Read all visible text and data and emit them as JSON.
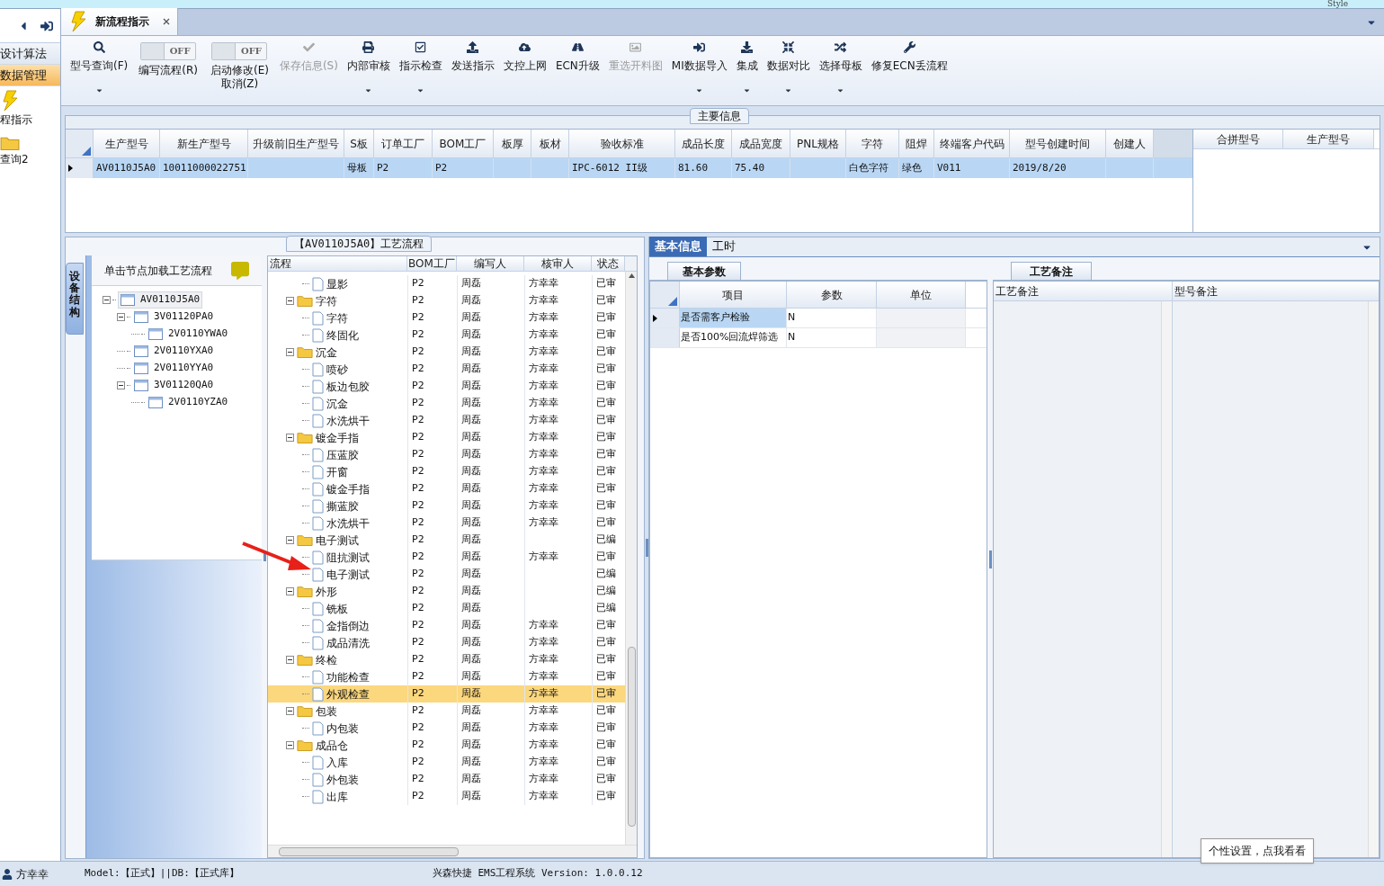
{
  "top_bar": {
    "style_label": "Style"
  },
  "nav": {
    "items": [
      {
        "label": "设计算法",
        "selected": false,
        "kind": "text"
      },
      {
        "label": "数据管理",
        "selected": true,
        "kind": "text"
      },
      {
        "label": "程指示",
        "selected": false,
        "kind": "lightning"
      },
      {
        "label": "查询2",
        "selected": false,
        "kind": "folder"
      }
    ]
  },
  "tabs": [
    {
      "label": "新流程指示",
      "selected": true
    }
  ],
  "toolbar": [
    {
      "kind": "button",
      "label": "型号查询(F)",
      "dropdown": true,
      "disabled": false
    },
    {
      "kind": "toggle",
      "label": "编写流程(R)",
      "toggle_text": "OFF",
      "on": false
    },
    {
      "kind": "toggle",
      "label": "启动修改(E)",
      "sublabel": "取消(Z)",
      "toggle_text": "OFF",
      "on": false
    },
    {
      "kind": "button",
      "label": "保存信息(S)",
      "dropdown": false,
      "disabled": true
    },
    {
      "kind": "button",
      "label": "内部审核",
      "dropdown": true,
      "disabled": false
    },
    {
      "kind": "button",
      "label": "指示检查",
      "dropdown": true,
      "disabled": false
    },
    {
      "kind": "button",
      "label": "发送指示",
      "dropdown": false,
      "disabled": false
    },
    {
      "kind": "button",
      "label": "文控上网",
      "dropdown": false,
      "disabled": false
    },
    {
      "kind": "button",
      "label": "ECN升级",
      "dropdown": false,
      "disabled": false
    },
    {
      "kind": "button",
      "label": "重选开料图",
      "dropdown": false,
      "disabled": true
    },
    {
      "kind": "button",
      "label": "MI数据导入",
      "dropdown": true,
      "disabled": false
    },
    {
      "kind": "button",
      "label": "集成",
      "dropdown": true,
      "disabled": false
    },
    {
      "kind": "button",
      "label": "数据对比",
      "dropdown": true,
      "disabled": false
    },
    {
      "kind": "button",
      "label": "选择母板",
      "dropdown": true,
      "disabled": false
    },
    {
      "kind": "button",
      "label": "修复ECN丢流程",
      "dropdown": false,
      "disabled": false
    }
  ],
  "main_info": {
    "title": "主要信息",
    "columns": [
      "生产型号",
      "新生产型号",
      "升级前旧生产型号",
      "S板",
      "订单工厂",
      "BOM工厂",
      "板厚",
      "板材",
      "验收标准",
      "成品长度",
      "成品宽度",
      "PNL规格",
      "字符",
      "阻焊",
      "终端客户代码",
      "型号创建时间",
      "创建人"
    ],
    "rows": [
      {
        "selected": true,
        "cells": [
          "AV0110J5A0",
          "10011000022751",
          "",
          "母板",
          "P2",
          "P2",
          "",
          "",
          "IPC-6012 II级",
          "81.60",
          "75.40",
          "",
          "白色字符",
          "绿色",
          "V011",
          "2019/8/20",
          ""
        ]
      }
    ],
    "merge_columns": [
      "合拼型号",
      "生产型号"
    ]
  },
  "structure": {
    "side_tab": "设备结构",
    "hint": "单击节点加载工艺流程",
    "tree": [
      {
        "label": "AV0110J5A0",
        "selected": true,
        "expanded": true,
        "children": [
          {
            "label": "3V01120PA0",
            "selected": false,
            "expanded": true,
            "children": [
              {
                "label": "2V0110YWA0",
                "selected": false
              }
            ]
          },
          {
            "label": "2V0110YXA0",
            "selected": false
          },
          {
            "label": "2V0110YYA0",
            "selected": false
          },
          {
            "label": "3V01120QA0",
            "selected": false,
            "expanded": true,
            "children": [
              {
                "label": "2V0110YZA0",
                "selected": false
              }
            ]
          }
        ]
      }
    ]
  },
  "flow": {
    "title": "【AV0110J5A0】工艺流程",
    "columns": [
      "流程",
      "BOM工厂",
      "编写人",
      "核审人",
      "状态"
    ],
    "rows": [
      {
        "kind": "leaf",
        "name": "显影",
        "bom": "P2",
        "writer": "周磊",
        "reviewer": "方幸幸",
        "status": "已审",
        "selected": false
      },
      {
        "kind": "folder",
        "name": "字符",
        "bom": "P2",
        "writer": "周磊",
        "reviewer": "方幸幸",
        "status": "已审",
        "selected": false,
        "children": [
          {
            "kind": "leaf",
            "name": "字符",
            "bom": "P2",
            "writer": "周磊",
            "reviewer": "方幸幸",
            "status": "已审",
            "selected": false
          },
          {
            "kind": "leaf",
            "name": "终固化",
            "bom": "P2",
            "writer": "周磊",
            "reviewer": "方幸幸",
            "status": "已审",
            "selected": false
          }
        ]
      },
      {
        "kind": "folder",
        "name": "沉金",
        "bom": "P2",
        "writer": "周磊",
        "reviewer": "方幸幸",
        "status": "已审",
        "selected": false,
        "children": [
          {
            "kind": "leaf",
            "name": "喷砂",
            "bom": "P2",
            "writer": "周磊",
            "reviewer": "方幸幸",
            "status": "已审",
            "selected": false
          },
          {
            "kind": "leaf",
            "name": "板边包胶",
            "bom": "P2",
            "writer": "周磊",
            "reviewer": "方幸幸",
            "status": "已审",
            "selected": false
          },
          {
            "kind": "leaf",
            "name": "沉金",
            "bom": "P2",
            "writer": "周磊",
            "reviewer": "方幸幸",
            "status": "已审",
            "selected": false
          },
          {
            "kind": "leaf",
            "name": "水洗烘干",
            "bom": "P2",
            "writer": "周磊",
            "reviewer": "方幸幸",
            "status": "已审",
            "selected": false
          }
        ]
      },
      {
        "kind": "folder",
        "name": "镀金手指",
        "bom": "P2",
        "writer": "周磊",
        "reviewer": "方幸幸",
        "status": "已审",
        "selected": false,
        "children": [
          {
            "kind": "leaf",
            "name": "压蓝胶",
            "bom": "P2",
            "writer": "周磊",
            "reviewer": "方幸幸",
            "status": "已审",
            "selected": false
          },
          {
            "kind": "leaf",
            "name": "开窗",
            "bom": "P2",
            "writer": "周磊",
            "reviewer": "方幸幸",
            "status": "已审",
            "selected": false
          },
          {
            "kind": "leaf",
            "name": "镀金手指",
            "bom": "P2",
            "writer": "周磊",
            "reviewer": "方幸幸",
            "status": "已审",
            "selected": false
          },
          {
            "kind": "leaf",
            "name": "撕蓝胶",
            "bom": "P2",
            "writer": "周磊",
            "reviewer": "方幸幸",
            "status": "已审",
            "selected": false
          },
          {
            "kind": "leaf",
            "name": "水洗烘干",
            "bom": "P2",
            "writer": "周磊",
            "reviewer": "方幸幸",
            "status": "已审",
            "selected": false
          }
        ]
      },
      {
        "kind": "folder",
        "name": "电子测试",
        "bom": "P2",
        "writer": "周磊",
        "status": "已编",
        "selected": false,
        "children": [
          {
            "kind": "leaf",
            "name": "阻抗测试",
            "bom": "P2",
            "writer": "周磊",
            "reviewer": "方幸幸",
            "status": "已审",
            "selected": false
          },
          {
            "kind": "leaf",
            "name": "电子测试",
            "bom": "P2",
            "writer": "周磊",
            "status": "已编",
            "selected": false
          }
        ]
      },
      {
        "kind": "folder",
        "name": "外形",
        "bom": "P2",
        "writer": "周磊",
        "status": "已编",
        "selected": false,
        "children": [
          {
            "kind": "leaf",
            "name": "铣板",
            "bom": "P2",
            "writer": "周磊",
            "status": "已编",
            "selected": false
          },
          {
            "kind": "leaf",
            "name": "金指倒边",
            "bom": "P2",
            "writer": "周磊",
            "reviewer": "方幸幸",
            "status": "已审",
            "selected": false
          },
          {
            "kind": "leaf",
            "name": "成品清洗",
            "bom": "P2",
            "writer": "周磊",
            "reviewer": "方幸幸",
            "status": "已审",
            "selected": false
          }
        ]
      },
      {
        "kind": "folder",
        "name": "终检",
        "bom": "P2",
        "writer": "周磊",
        "reviewer": "方幸幸",
        "status": "已审",
        "selected": false,
        "children": [
          {
            "kind": "leaf",
            "name": "功能检查",
            "bom": "P2",
            "writer": "周磊",
            "reviewer": "方幸幸",
            "status": "已审",
            "selected": false
          },
          {
            "kind": "leaf",
            "name": "外观检查",
            "bom": "P2",
            "writer": "周磊",
            "reviewer": "方幸幸",
            "status": "已审",
            "selected": true
          }
        ]
      },
      {
        "kind": "folder",
        "name": "包装",
        "bom": "P2",
        "writer": "周磊",
        "reviewer": "方幸幸",
        "status": "已审",
        "selected": false,
        "children": [
          {
            "kind": "leaf",
            "name": "内包装",
            "bom": "P2",
            "writer": "周磊",
            "reviewer": "方幸幸",
            "status": "已审",
            "selected": false
          }
        ]
      },
      {
        "kind": "folder",
        "name": "成品仓",
        "bom": "P2",
        "writer": "周磊",
        "reviewer": "方幸幸",
        "status": "已审",
        "selected": false,
        "children": [
          {
            "kind": "leaf",
            "name": "入库",
            "bom": "P2",
            "writer": "周磊",
            "reviewer": "方幸幸",
            "status": "已审",
            "selected": false
          },
          {
            "kind": "leaf",
            "name": "外包装",
            "bom": "P2",
            "writer": "周磊",
            "reviewer": "方幸幸",
            "status": "已审",
            "selected": false
          },
          {
            "kind": "leaf",
            "name": "出库",
            "bom": "P2",
            "writer": "周磊",
            "reviewer": "方幸幸",
            "status": "已审",
            "selected": false
          }
        ]
      }
    ]
  },
  "detail": {
    "tabs": [
      {
        "label": "基本信息",
        "selected": true
      },
      {
        "label": "工时",
        "selected": false
      }
    ],
    "params": {
      "tab": "基本参数",
      "columns": [
        "项目",
        "参数",
        "单位"
      ],
      "rows": [
        {
          "selected": true,
          "cells": [
            "是否需客户检验",
            "N",
            ""
          ]
        },
        {
          "selected": false,
          "cells": [
            "是否100%回流焊筛选",
            "N",
            ""
          ]
        }
      ]
    },
    "notes": {
      "tab": "工艺备注",
      "columns": [
        "工艺备注",
        "型号备注"
      ]
    }
  },
  "status_bar": {
    "user": "方幸幸",
    "model": "Model:【正式】||DB:【正式库】",
    "app": "兴森快捷 EMS工程系统 Version: 1.0.0.12",
    "tooltip": "个性设置，点我看看"
  }
}
